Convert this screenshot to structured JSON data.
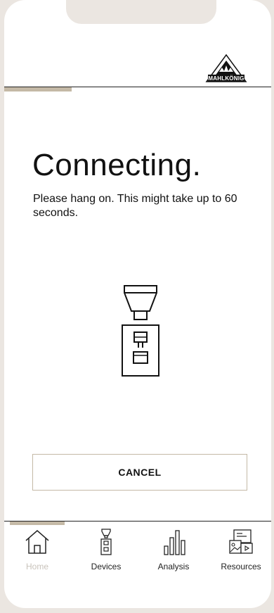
{
  "brand": {
    "logo_text": "MAHLKÖNIG"
  },
  "connecting": {
    "title": "Connecting.",
    "message": "Please hang on. This might take up to 60 seconds."
  },
  "actions": {
    "cancel_label": "CANCEL"
  },
  "tabbar": {
    "active": "Home",
    "tabs": [
      {
        "label": "Home",
        "icon": "home-icon"
      },
      {
        "label": "Devices",
        "icon": "grinder-icon"
      },
      {
        "label": "Analysis",
        "icon": "bar-chart-icon"
      },
      {
        "label": "Resources",
        "icon": "resources-icon"
      }
    ]
  },
  "colors": {
    "accent": "#c4b9a6",
    "background": "#ebe6e1",
    "text": "#111111",
    "inactive_tab_label": "#c9c3bb"
  }
}
